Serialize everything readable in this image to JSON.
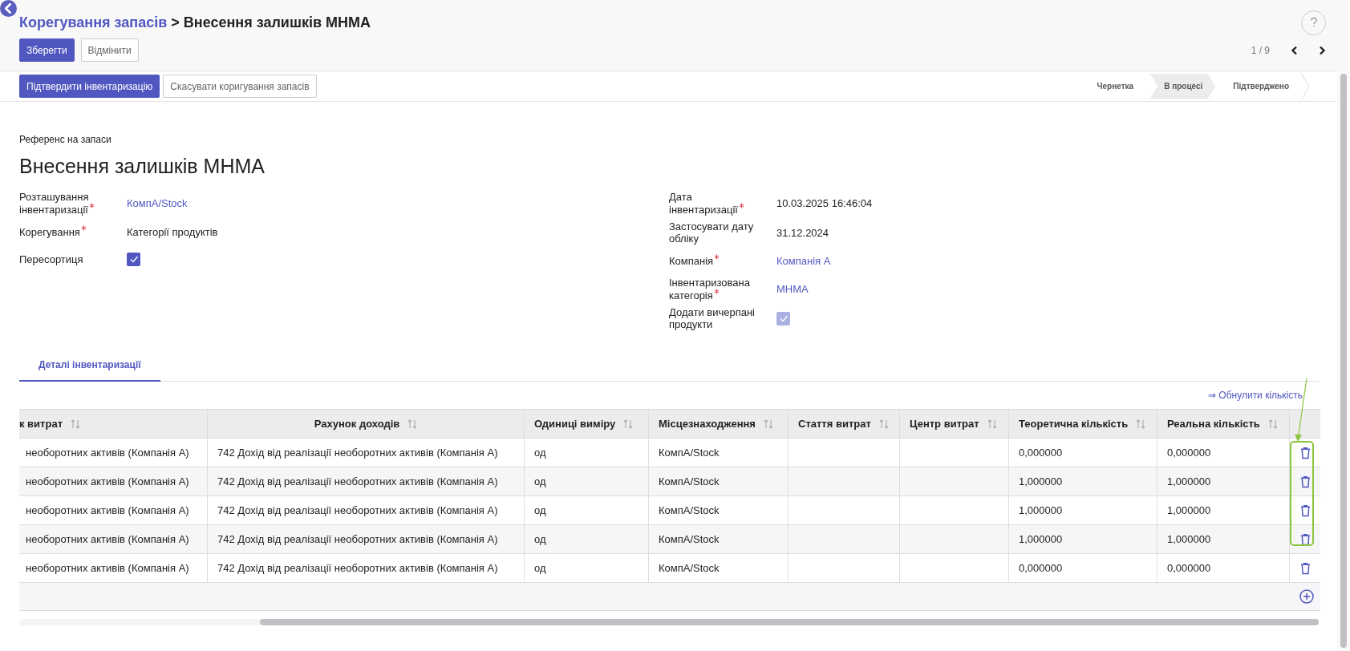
{
  "breadcrumb": {
    "parent": "Корегування запасів",
    "separator": ">",
    "current": "Внесення залишків МНМА"
  },
  "actions": [
    "Зберегти",
    "Відмінити"
  ],
  "pager": {
    "text": "1 / 9"
  },
  "status_buttons": [
    "Підтвердити інвентаризацію",
    "Скасувати коригування запасів"
  ],
  "stages": [
    {
      "label": "Чернетка",
      "selected": false
    },
    {
      "label": "В процесі",
      "selected": true
    },
    {
      "label": "Підтверджено",
      "selected": false
    }
  ],
  "form": {
    "reference_label": "Референс на запаси",
    "title": "Внесення залишків МНМА",
    "left_fields": [
      {
        "label": "Розташування інвентаризації",
        "required": true,
        "kind": "link",
        "value": "КомпА/Stock"
      },
      {
        "label": "Корегування",
        "required": true,
        "kind": "text",
        "value": "Категорії продуктів"
      },
      {
        "label": "Пересортиця",
        "required": false,
        "kind": "checkbox",
        "checked": true,
        "disabled": false
      }
    ],
    "right_fields": [
      {
        "label": "Дата інвентаризації",
        "required": true,
        "kind": "text",
        "value": "10.03.2025 16:46:04"
      },
      {
        "label": "Застосувати дату обліку",
        "required": false,
        "kind": "text",
        "value": "31.12.2024"
      },
      {
        "label": "Компанія",
        "required": true,
        "kind": "link",
        "value": "Компанія А"
      },
      {
        "label": "Інвентаризована категорія",
        "required": true,
        "kind": "link",
        "value": "МНМА"
      },
      {
        "label": "Додати вичерпані продукти",
        "required": false,
        "kind": "checkbox",
        "checked": true,
        "disabled": true
      }
    ]
  },
  "tabs": [
    {
      "label": "Деталі інвентаризації",
      "selected": true
    }
  ],
  "reset_link": "⇒ Обнулити кількість",
  "table": {
    "columns": [
      "к витрат",
      "Рахунок доходів",
      "Одиниці виміру",
      "Місцезнаходження",
      "Стаття витрат",
      "Центр витрат",
      "Теоретична кількість",
      "Реальна кількість"
    ],
    "rows": [
      [
        "необоротних активів (Компанія А)",
        "742 Дохід від реалізації необоротних активів (Компанія А)",
        "од",
        "КомпА/Stock",
        "",
        "",
        "0,000000",
        "0,000000"
      ],
      [
        "необоротних активів (Компанія А)",
        "742 Дохід від реалізації необоротних активів (Компанія А)",
        "од",
        "КомпА/Stock",
        "",
        "",
        "1,000000",
        "1,000000"
      ],
      [
        "необоротних активів (Компанія А)",
        "742 Дохід від реалізації необоротних активів (Компанія А)",
        "од",
        "КомпА/Stock",
        "",
        "",
        "1,000000",
        "1,000000"
      ],
      [
        "необоротних активів (Компанія А)",
        "742 Дохід від реалізації необоротних активів (Компанія А)",
        "од",
        "КомпА/Stock",
        "",
        "",
        "1,000000",
        "1,000000"
      ],
      [
        "необоротних активів (Компанія А)",
        "742 Дохід від реалізації необоротних активів (Компанія А)",
        "од",
        "КомпА/Stock",
        "",
        "",
        "0,000000",
        "0,000000"
      ]
    ]
  }
}
